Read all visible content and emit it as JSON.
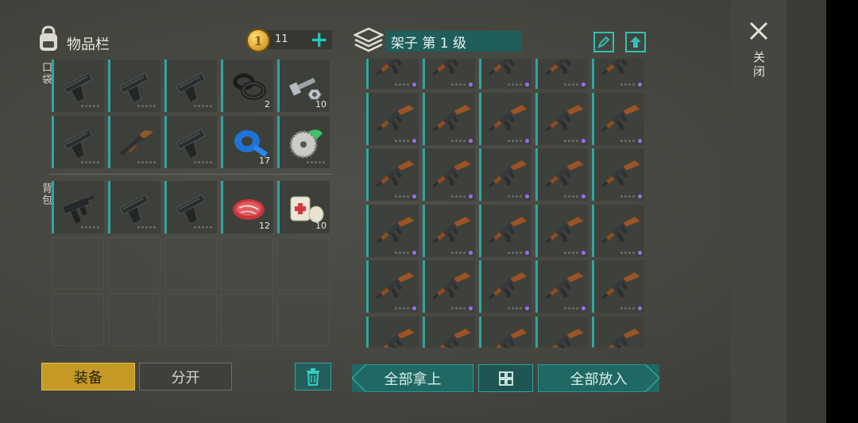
{
  "inventory": {
    "title": "物品栏",
    "coins": "11",
    "sections": {
      "pocket": "口袋",
      "backpack": "背包"
    },
    "pocket_rows": [
      [
        {
          "icon": "pistol-icon",
          "count": ""
        },
        {
          "icon": "pistol-icon",
          "count": ""
        },
        {
          "icon": "pistol-icon",
          "count": ""
        },
        {
          "icon": "rubber-rings-icon",
          "count": "2"
        },
        {
          "icon": "bolt-nut-icon",
          "count": "10"
        }
      ],
      [
        {
          "icon": "pistol-icon",
          "count": ""
        },
        {
          "icon": "shotgun-icon",
          "count": ""
        },
        {
          "icon": "pistol-icon",
          "count": ""
        },
        {
          "icon": "duct-tape-icon",
          "count": "17"
        },
        {
          "icon": "saw-blade-icon",
          "count": ""
        }
      ]
    ],
    "backpack_rows": [
      [
        {
          "icon": "smg-icon",
          "count": ""
        },
        {
          "icon": "pistol-icon",
          "count": ""
        },
        {
          "icon": "pistol-icon",
          "count": ""
        },
        {
          "icon": "raw-meat-icon",
          "count": "12"
        },
        {
          "icon": "bandage-icon",
          "count": "10"
        }
      ]
    ],
    "equip_label": "装备",
    "split_label": "分开"
  },
  "shelf": {
    "title": "架子 第 1 级",
    "item_icon": "ak-rifle-icon",
    "rows": 6,
    "cols": 5,
    "take_all_label": "全部拿上",
    "put_all_label": "全部放入"
  },
  "close_label": "关闭",
  "colors": {
    "accent": "#2fa6a0",
    "gold": "#c49a25",
    "rarity": "#9d6cf0"
  }
}
